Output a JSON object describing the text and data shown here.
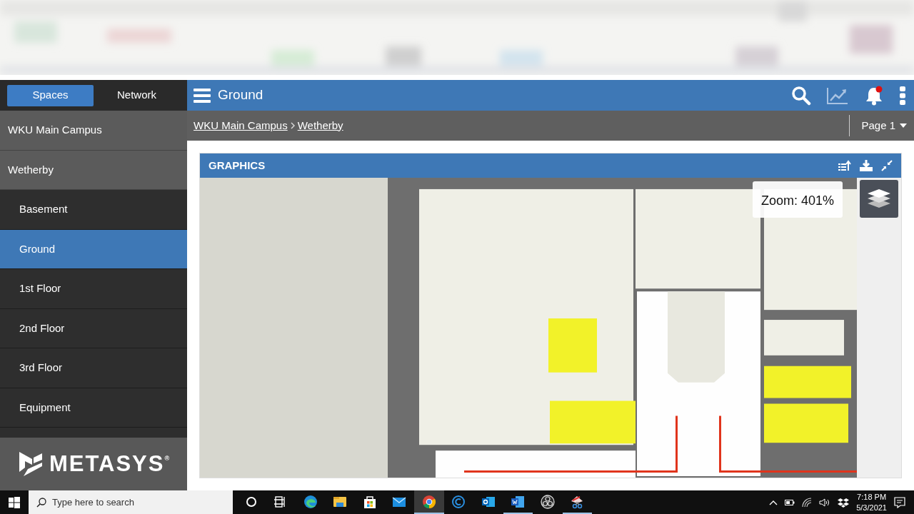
{
  "sidebar": {
    "tabs": [
      {
        "label": "Spaces",
        "selected": true
      },
      {
        "label": "Network",
        "selected": false
      }
    ],
    "items": [
      {
        "label": "WKU Main Campus",
        "selected": false,
        "children": [
          {
            "label": "Wetherby",
            "selected": false,
            "children": [
              {
                "label": "Basement",
                "selected": false
              },
              {
                "label": "Ground",
                "selected": true
              },
              {
                "label": "1st Floor",
                "selected": false
              },
              {
                "label": "2nd Floor",
                "selected": false
              },
              {
                "label": "3rd Floor",
                "selected": false
              },
              {
                "label": "Equipment",
                "selected": false
              }
            ]
          }
        ]
      }
    ],
    "logo": "METASYS$^{®}$"
  },
  "header": {
    "title": "Ground",
    "notifications": {
      "unread": true
    }
  },
  "breadcrumb": [
    "WKU Main Campus",
    "Wetherby"
  ],
  "page_menu": "Page 1",
  "panel": {
    "title": "GRAPHICS",
    "zoom": "Zoom: 401%"
  },
  "taskbar": {
    "search": {
      "placeholder": "Type here to search"
    },
    "apps": [
      {
        "kind": "cortana",
        "selected": false,
        "running": false
      },
      {
        "kind": "taskview",
        "selected": false,
        "running": false
      },
      {
        "kind": "edge",
        "selected": false,
        "running": false
      },
      {
        "kind": "explorer",
        "selected": false,
        "running": false
      },
      {
        "kind": "store",
        "selected": false,
        "running": false
      },
      {
        "kind": "mail",
        "selected": false,
        "running": false
      },
      {
        "kind": "chrome",
        "selected": true,
        "running": true
      },
      {
        "kind": "capp",
        "selected": false,
        "running": false
      },
      {
        "kind": "outlook",
        "selected": false,
        "running": false
      },
      {
        "kind": "word",
        "selected": false,
        "running": true
      },
      {
        "kind": "obs",
        "selected": false,
        "running": false
      },
      {
        "kind": "snip",
        "selected": false,
        "running": true
      }
    ],
    "time": "7:18 PM",
    "date": "5/3/2021"
  }
}
